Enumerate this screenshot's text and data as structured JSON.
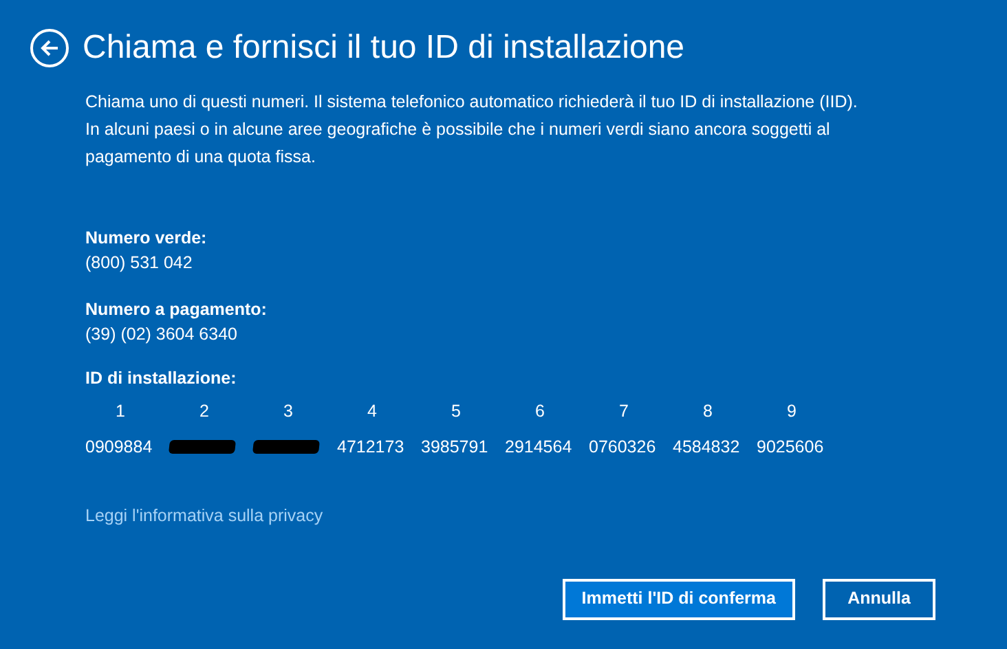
{
  "title": "Chiama e fornisci il tuo ID di installazione",
  "intro": "Chiama uno di questi numeri. Il sistema telefonico automatico richiederà il tuo ID di installazione (IID). In alcuni paesi o in alcune aree geografiche è possibile che i numeri verdi siano ancora soggetti al pagamento di una quota fissa.",
  "phones": [
    {
      "label": "Numero verde:",
      "value": "(800) 531 042"
    },
    {
      "label": "Numero a pagamento:",
      "value": "(39) (02) 3604 6340"
    }
  ],
  "installation_id": {
    "label": "ID di installazione:",
    "groups": [
      {
        "index": "1",
        "value": "0909884",
        "redacted": false
      },
      {
        "index": "2",
        "redacted": true
      },
      {
        "index": "3",
        "redacted": true
      },
      {
        "index": "4",
        "value": "4712173",
        "redacted": false
      },
      {
        "index": "5",
        "value": "3985791",
        "redacted": false
      },
      {
        "index": "6",
        "value": "2914564",
        "redacted": false
      },
      {
        "index": "7",
        "value": "0760326",
        "redacted": false
      },
      {
        "index": "8",
        "value": "4584832",
        "redacted": false
      },
      {
        "index": "9",
        "value": "9025606",
        "redacted": false
      }
    ]
  },
  "privacy_link": "Leggi l'informativa sulla privacy",
  "buttons": [
    {
      "label": "Immetti l'ID di conferma",
      "primary": true
    },
    {
      "label": "Annulla",
      "primary": false
    }
  ]
}
